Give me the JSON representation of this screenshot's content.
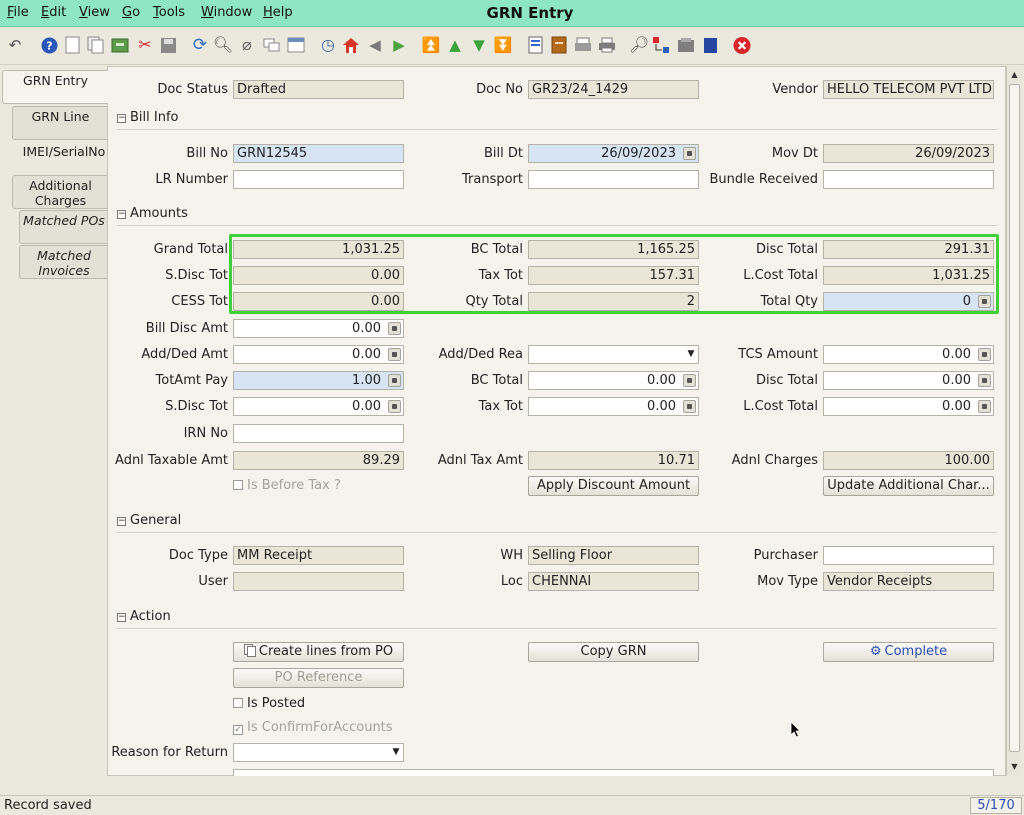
{
  "window": {
    "title": "GRN Entry"
  },
  "menu": [
    "File",
    "Edit",
    "View",
    "Go",
    "Tools",
    "Window",
    "Help"
  ],
  "side_tabs": [
    {
      "label": "GRN Entry",
      "active": true
    },
    {
      "label": "GRN Line"
    },
    {
      "label": "IMEI/SerialNo"
    },
    {
      "label": "Additional Charges"
    },
    {
      "label": "Matched POs"
    },
    {
      "label": "Matched Invoices"
    }
  ],
  "header": {
    "doc_status_label": "Doc Status",
    "doc_status": "Drafted",
    "doc_no_label": "Doc No",
    "doc_no": "GR23/24_1429",
    "vendor_label": "Vendor",
    "vendor": "HELLO TELECOM PVT LTD"
  },
  "sections": {
    "bill_info": "Bill Info",
    "amounts": "Amounts",
    "general": "General",
    "action": "Action"
  },
  "bill_info": {
    "bill_no_label": "Bill No",
    "bill_no": "GRN12545",
    "bill_dt_label": "Bill Dt",
    "bill_dt": "26/09/2023",
    "mov_dt_label": "Mov Dt",
    "mov_dt": "26/09/2023",
    "lr_number_label": "LR Number",
    "lr_number": "",
    "transport_label": "Transport",
    "transport": "",
    "bundle_received_label": "Bundle Received",
    "bundle_received": ""
  },
  "amounts": {
    "grand_total_label": "Grand Total",
    "grand_total": "1,031.25",
    "bc_total_label": "BC Total",
    "bc_total": "1,165.25",
    "disc_total_label": "Disc Total",
    "disc_total": "291.31",
    "s_disc_tot_label": "S.Disc Tot",
    "s_disc_tot": "0.00",
    "tax_tot_label": "Tax Tot",
    "tax_tot": "157.31",
    "l_cost_total_label": "L.Cost Total",
    "l_cost_total": "1,031.25",
    "cess_tot_label": "CESS Tot",
    "cess_tot": "0.00",
    "qty_total_label": "Qty Total",
    "qty_total": "2",
    "total_qty_label": "Total Qty",
    "total_qty": "0",
    "bill_disc_amt_label": "Bill Disc Amt",
    "bill_disc_amt": "0.00",
    "add_ded_amt_label": "Add/Ded Amt",
    "add_ded_amt": "0.00",
    "add_ded_rea_label": "Add/Ded Rea",
    "add_ded_rea": "",
    "tcs_amount_label": "TCS Amount",
    "tcs_amount": "0.00",
    "totamt_pay_label": "TotAmt Pay",
    "totamt_pay": "1.00",
    "bc_total2_label": "BC Total",
    "bc_total2": "0.00",
    "disc_total2_label": "Disc Total",
    "disc_total2": "0.00",
    "s_disc_tot2_label": "S.Disc Tot",
    "s_disc_tot2": "0.00",
    "tax_tot2_label": "Tax Tot",
    "tax_tot2": "0.00",
    "l_cost_total2_label": "L.Cost Total",
    "l_cost_total2": "0.00",
    "irn_no_label": "IRN No",
    "irn_no": "",
    "adnl_taxable_amt_label": "Adnl Taxable Amt",
    "adnl_taxable_amt": "89.29",
    "adnl_tax_amt_label": "Adnl Tax Amt",
    "adnl_tax_amt": "10.71",
    "adnl_charges_label": "Adnl Charges",
    "adnl_charges": "100.00",
    "is_before_tax_label": "Is Before Tax ?",
    "apply_discount_label": "Apply Discount Amount",
    "update_additional_label": "Update Additional Char..."
  },
  "general": {
    "doc_type_label": "Doc Type",
    "doc_type": "MM Receipt",
    "wh_label": "WH",
    "wh": "Selling Floor",
    "purchaser_label": "Purchaser",
    "purchaser": "",
    "user_label": "User",
    "user": "",
    "loc_label": "Loc",
    "loc": "CHENNAI",
    "mov_type_label": "Mov Type",
    "mov_type": "Vendor Receipts"
  },
  "action": {
    "create_lines_label": "Create lines from PO",
    "copy_grn_label": "Copy GRN",
    "complete_label": "Complete",
    "po_reference_label": "PO Reference",
    "is_posted_label": "Is Posted",
    "is_confirm_label": "Is ConfirmForAccounts",
    "reason_return_label": "Reason for Return",
    "reason_return": ""
  },
  "status": {
    "message": "Record saved",
    "record_counter": "5/170"
  },
  "colors": {
    "title_bar": "#8fe6c7",
    "highlight": "#3fd13a",
    "link_blue": "#2a4fb7",
    "delete_red": "#d9262a"
  }
}
